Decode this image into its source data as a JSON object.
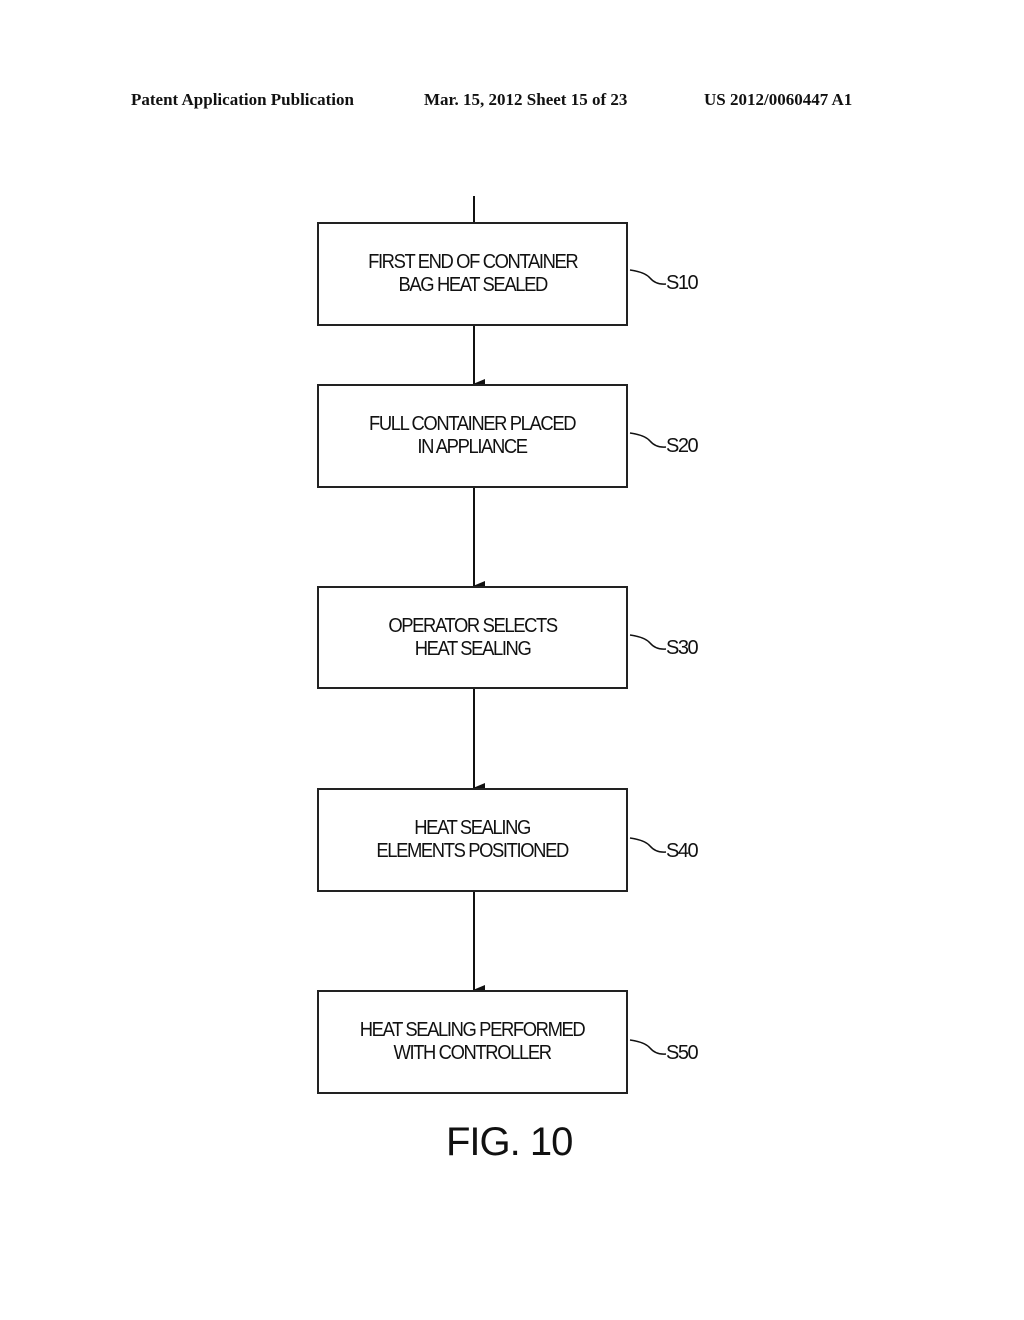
{
  "header": {
    "publication": "Patent Application Publication",
    "date_sheet": "Mar. 15, 2012  Sheet 15 of 23",
    "number": "US 2012/0060447 A1"
  },
  "steps": [
    {
      "label": "S10",
      "text": "FIRST END OF CONTAINER\nBAG HEAT SEALED"
    },
    {
      "label": "S20",
      "text": "FULL CONTAINER PLACED\nIN APPLIANCE"
    },
    {
      "label": "S30",
      "text": "OPERATOR SELECTS\nHEAT SEALING"
    },
    {
      "label": "S40",
      "text": "HEAT SEALING\nELEMENTS POSITIONED"
    },
    {
      "label": "S50",
      "text": "HEAT SEALING PERFORMED\nWITH CONTROLLER"
    }
  ],
  "figure_caption": "FIG. 10"
}
